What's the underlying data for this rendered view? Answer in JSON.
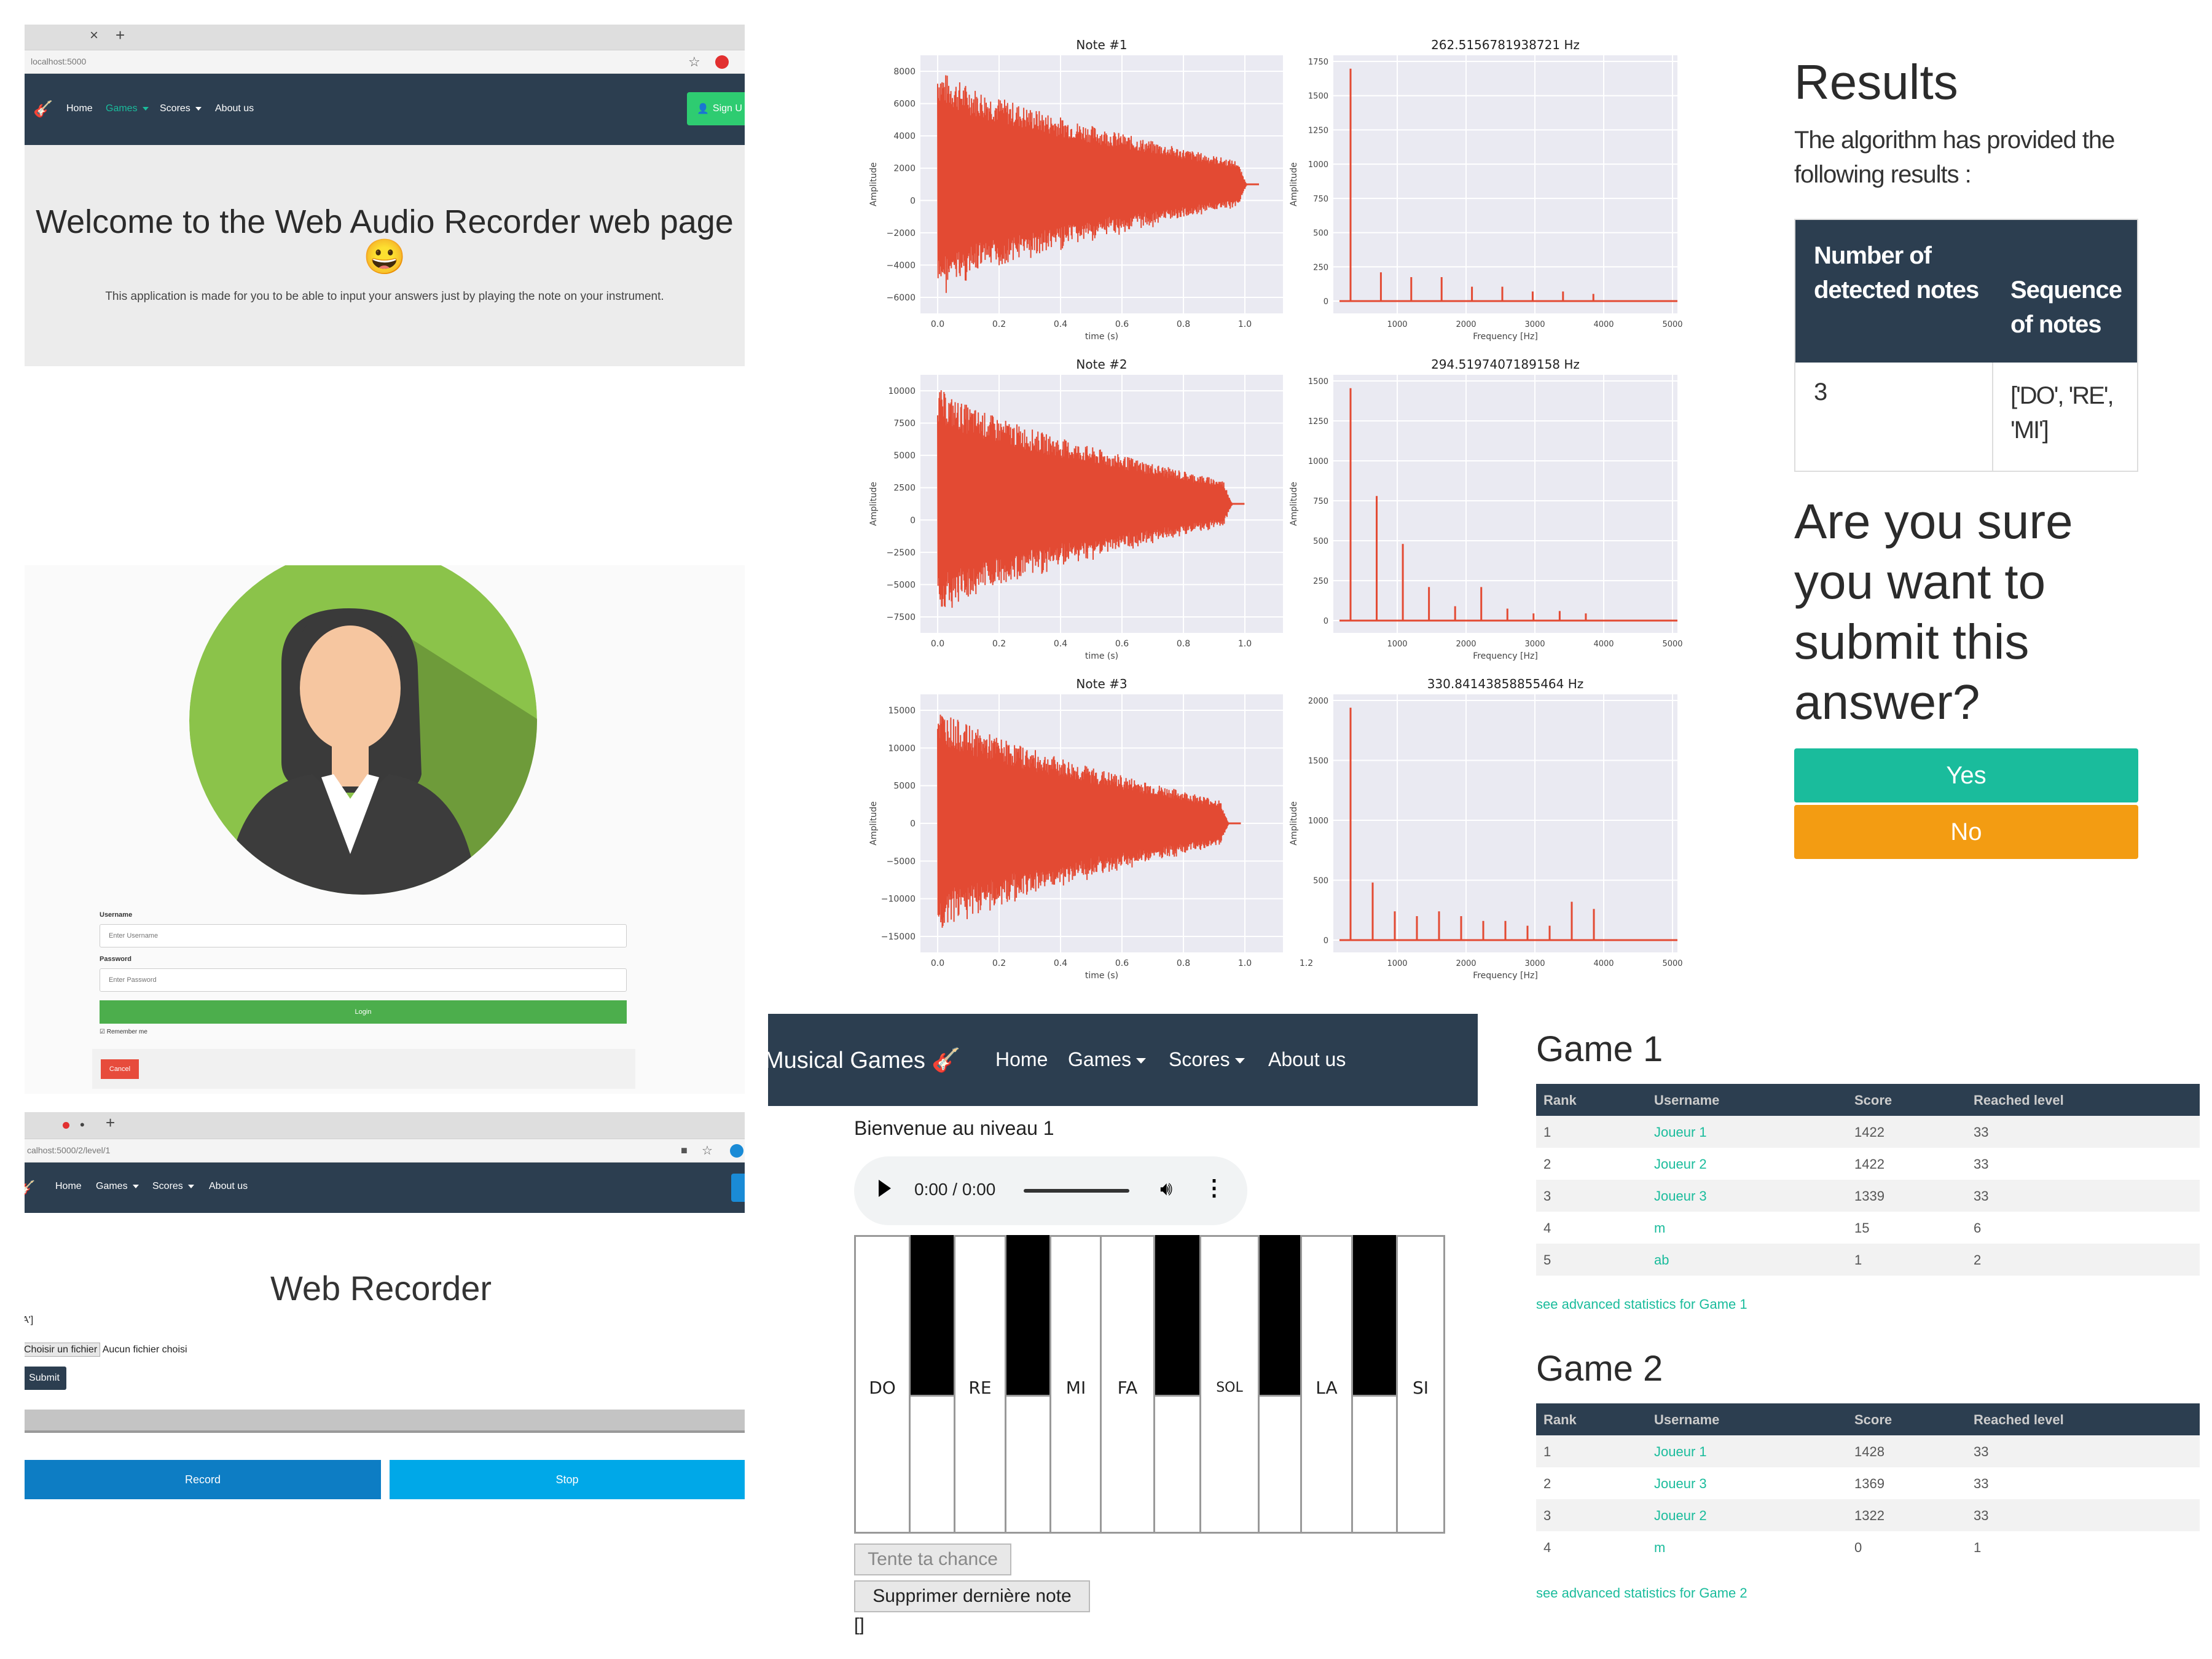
{
  "home": {
    "url": "localhost:5000",
    "nav": {
      "home": "Home",
      "games": "Games",
      "scores": "Scores",
      "about": "About us",
      "signup": "Sign U"
    },
    "title": "Welcome to the Web Audio Recorder web page",
    "emoji": "😀",
    "subtitle": "This application is made for you to be able to input your answers just by playing the note on your instrument."
  },
  "login": {
    "username_label": "Username",
    "username_placeholder": "Enter Username",
    "password_label": "Password",
    "password_placeholder": "Enter Password",
    "login_button": "Login",
    "remember": "Remember me",
    "cancel_button": "Cancel"
  },
  "recorder": {
    "url": "calhost:5000/2/level/1",
    "nav": {
      "home": "Home",
      "games": "Games",
      "scores": "Scores",
      "about": "About us"
    },
    "title": "Web Recorder",
    "side_text": "A']",
    "choose_file": "Choisir un fichier",
    "no_file": "Aucun fichier choisi",
    "submit": "Submit",
    "record": "Record",
    "stop": "Stop"
  },
  "analysis": {
    "notes": [
      {
        "title": "Note #1",
        "freq_title": "262.5156781938721 Hz",
        "ylabel": "Amplitude",
        "xlabel": "time (s)",
        "fxlabel": "Frequency [Hz]",
        "y_ticks": [
          "8000",
          "6000",
          "4000",
          "2000",
          "0",
          "−2000",
          "−4000",
          "−6000"
        ],
        "x_ticks": [
          "0.0",
          "0.2",
          "0.4",
          "0.6",
          "0.8",
          "1.0"
        ],
        "fy_ticks": [
          "1750",
          "1500",
          "1250",
          "1000",
          "750",
          "500",
          "250",
          "0"
        ],
        "fx_ticks": [
          "1000",
          "2000",
          "3000",
          "4000",
          "5000"
        ]
      },
      {
        "title": "Note #2",
        "freq_title": "294.5197407189158 Hz",
        "ylabel": "Amplitude",
        "xlabel": "time (s)",
        "fxlabel": "Frequency [Hz]",
        "y_ticks": [
          "10000",
          "7500",
          "5000",
          "2500",
          "0",
          "−2500",
          "−5000",
          "−7500"
        ],
        "x_ticks": [
          "0.0",
          "0.2",
          "0.4",
          "0.6",
          "0.8",
          "1.0"
        ],
        "fy_ticks": [
          "1500",
          "1250",
          "1000",
          "750",
          "500",
          "250",
          "0"
        ],
        "fx_ticks": [
          "1000",
          "2000",
          "3000",
          "4000",
          "5000"
        ]
      },
      {
        "title": "Note #3",
        "freq_title": "330.84143858855464 Hz",
        "ylabel": "Amplitude",
        "xlabel": "time (s)",
        "fxlabel": "Frequency [Hz]",
        "y_ticks": [
          "15000",
          "10000",
          "5000",
          "0",
          "−5000",
          "−10000",
          "−15000"
        ],
        "x_ticks": [
          "0.0",
          "0.2",
          "0.4",
          "0.6",
          "0.8",
          "1.0",
          "1.2"
        ],
        "fy_ticks": [
          "2000",
          "1500",
          "1000",
          "500",
          "0"
        ],
        "fx_ticks": [
          "1000",
          "2000",
          "3000",
          "4000",
          "5000"
        ]
      }
    ]
  },
  "results": {
    "title": "Results",
    "intro": "The algorithm has provided the following results :",
    "col1": "Number of detected notes",
    "col2": "Sequence of notes",
    "count": "3",
    "sequence": "['DO', 'RE', 'MI']",
    "confirm": "Are you sure you want to submit this answer?",
    "yes": "Yes",
    "no": "No"
  },
  "game": {
    "brand": "Musical Games",
    "nav": {
      "home": "Home",
      "games": "Games",
      "scores": "Scores",
      "about": "About us"
    },
    "welcome": "Bienvenue au niveau 1",
    "time": "0:00 / 0:00",
    "keys": [
      "DO",
      "RE",
      "MI",
      "FA",
      "SOL",
      "LA",
      "SI"
    ],
    "try_button": "Tente ta chance",
    "delete_button": "Supprimer dernière note",
    "output": "[]"
  },
  "scores": {
    "headers": [
      "Rank",
      "Username",
      "Score",
      "Reached level"
    ],
    "game1": {
      "title": "Game 1",
      "rows": [
        [
          "1",
          "Joueur 1",
          "1422",
          "33"
        ],
        [
          "2",
          "Joueur 2",
          "1422",
          "33"
        ],
        [
          "3",
          "Joueur 3",
          "1339",
          "33"
        ],
        [
          "4",
          "m",
          "15",
          "6"
        ],
        [
          "5",
          "ab",
          "1",
          "2"
        ]
      ],
      "link": "see advanced statistics for Game 1"
    },
    "game2": {
      "title": "Game 2",
      "rows": [
        [
          "1",
          "Joueur 1",
          "1428",
          "33"
        ],
        [
          "2",
          "Joueur 3",
          "1369",
          "33"
        ],
        [
          "3",
          "Joueur 2",
          "1322",
          "33"
        ],
        [
          "4",
          "m",
          "0",
          "1"
        ]
      ],
      "link": "see advanced statistics for Game 2"
    }
  },
  "colors": {
    "navy": "#2c3e50",
    "teal": "#1abc9c",
    "orange": "#f39c12",
    "green": "#4cae4c",
    "red": "#e74c3c",
    "blue": "#0d7dc4",
    "plot": "#e34a33"
  }
}
